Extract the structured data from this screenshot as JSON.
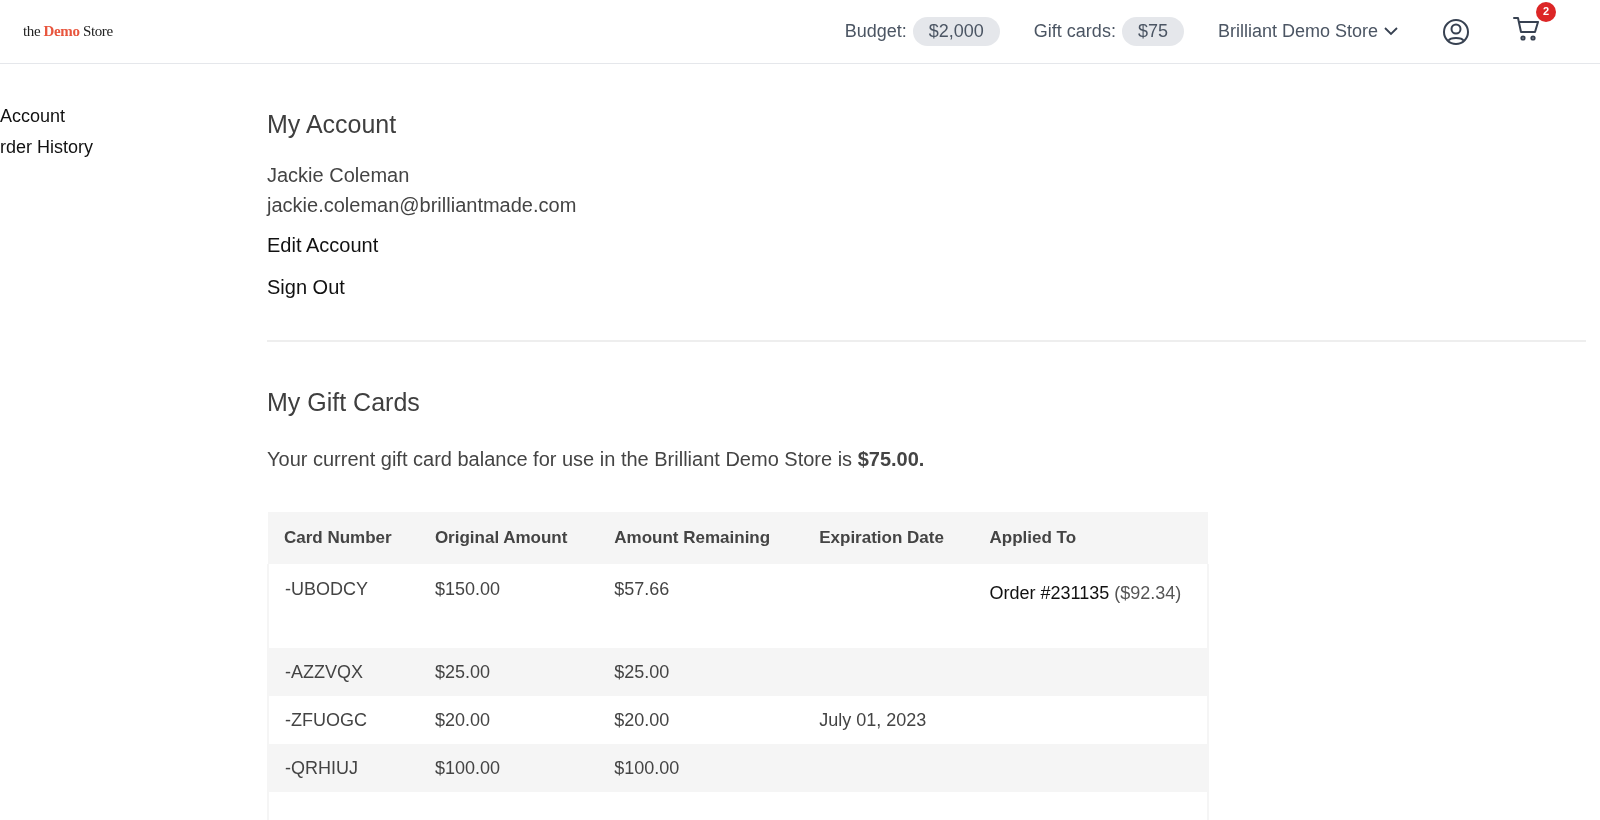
{
  "header": {
    "logo": {
      "prefix": "the",
      "highlight": "Demo",
      "suffix": "Store"
    },
    "budget": {
      "label": "Budget:",
      "value": "$2,000"
    },
    "gift_cards": {
      "label": "Gift cards:",
      "value": "$75"
    },
    "store_menu": "Brilliant Demo Store",
    "cart_count": "2"
  },
  "sidebar": {
    "items": [
      "Account",
      "rder History"
    ]
  },
  "account": {
    "title": "My Account",
    "name": "Jackie Coleman",
    "email": "jackie.coleman@brilliantmade.com",
    "links": [
      "Edit Account",
      "Sign Out"
    ]
  },
  "gift_cards": {
    "title": "My Gift Cards",
    "balance_text": "Your current gift card balance for use in the Brilliant Demo Store is **$75.00.**",
    "table": {
      "columns": [
        "Card Number",
        "Original Amount",
        "Amount Remaining",
        "Expiration Date",
        "Applied To"
      ],
      "rows": [
        {
          "card": "-UBODCY",
          "original": "$150.00",
          "remaining": "$57.66",
          "expiration": "",
          "applied": {
            "order": "Order #231135",
            "amount": "($92.34)"
          }
        },
        {
          "card": "-AZZVQX",
          "original": "$25.00",
          "remaining": "$25.00",
          "expiration": ""
        },
        {
          "card": "-ZFUOGC",
          "original": "$20.00",
          "remaining": "$20.00",
          "expiration": "July 01, 2023"
        },
        {
          "card": "-QRHIUJ",
          "original": "$100.00",
          "remaining": "$100.00",
          "expiration": ""
        }
      ]
    }
  }
}
